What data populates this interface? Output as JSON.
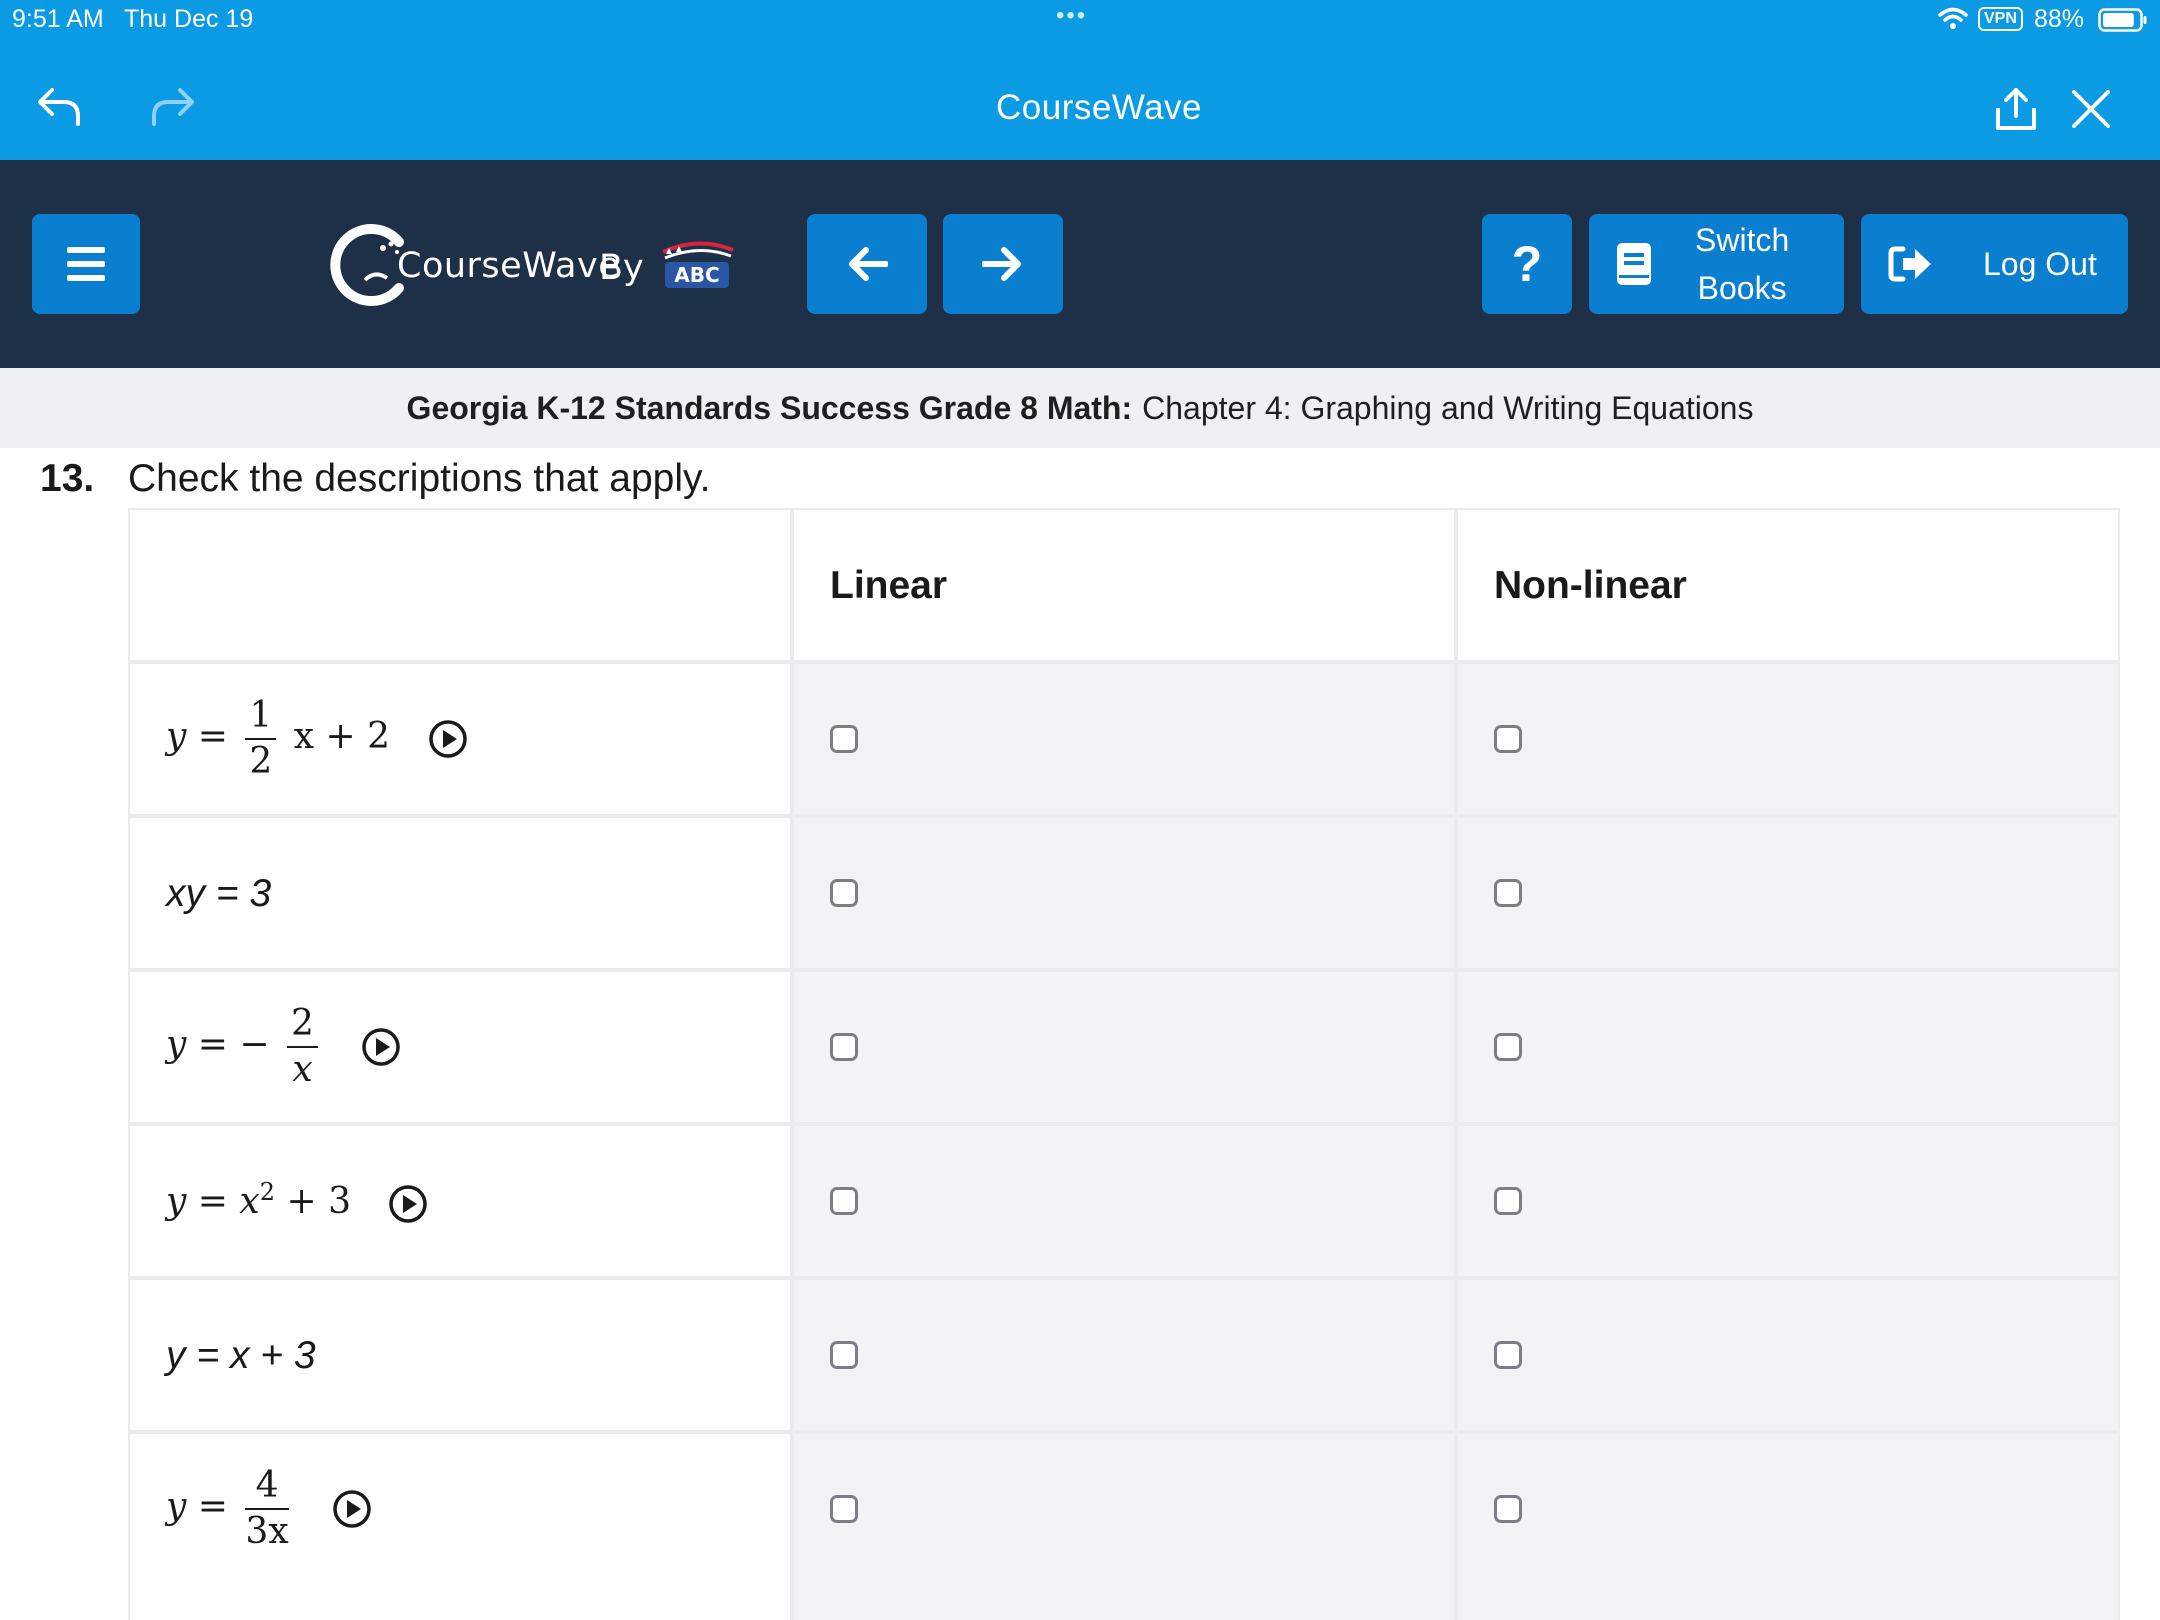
{
  "status_bar": {
    "time": "9:51 AM",
    "date": "Thu Dec 19",
    "vpn": "VPN",
    "battery_pct": "88%",
    "battery_level": 0.88
  },
  "app_bar": {
    "title": "CourseWave",
    "icons": [
      "undo-icon",
      "redo-icon",
      "share-icon",
      "close-icon"
    ]
  },
  "toolbar": {
    "logo_text": "CourseWave",
    "logo_by": "By",
    "logo_abc": "ABC",
    "help_label": "?",
    "switch_books_line1": "Switch",
    "switch_books_line2": "Books",
    "logout_label": "Log Out",
    "colors": {
      "bar": "#1e2f48",
      "button": "#0a7fd0",
      "appbar": "#0b9ae4"
    }
  },
  "breadcrumb": {
    "book": "Georgia K-12 Standards Success Grade 8 Math:",
    "chapter": "Chapter 4: Graphing and Writing Equations"
  },
  "question": {
    "number": "13.",
    "prompt": "Check the descriptions that apply.",
    "columns": [
      "Linear",
      "Non-linear"
    ],
    "rows": [
      {
        "lhs": "y",
        "eq": "=",
        "num": "1",
        "den": "2",
        "rest": "x + 2",
        "audio": true
      },
      {
        "text": "xy = 3",
        "audio": false
      },
      {
        "lhs": "y",
        "eq": "= −",
        "num": "2",
        "den": "x",
        "audio": true
      },
      {
        "lhs": "y",
        "eq": "=",
        "base": "x",
        "sup": "2",
        "rest": "+ 3",
        "audio": true
      },
      {
        "text": "y = x + 3",
        "audio": false
      },
      {
        "lhs": "y",
        "eq": "=",
        "num": "4",
        "den": "3x",
        "audio": true
      }
    ]
  }
}
